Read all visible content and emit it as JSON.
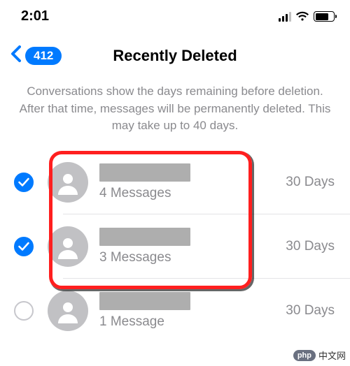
{
  "status": {
    "time": "2:01"
  },
  "nav": {
    "back_count": "412",
    "title": "Recently Deleted"
  },
  "description": "Conversations show the days remaining before deletion. After that time, messages will be permanently deleted. This may take up to 40 days.",
  "rows": [
    {
      "selected": true,
      "messages": "4 Messages",
      "remaining": "30 Days"
    },
    {
      "selected": true,
      "messages": "3 Messages",
      "remaining": "30 Days"
    },
    {
      "selected": false,
      "messages": "1 Message",
      "remaining": "30 Days"
    }
  ],
  "watermark": {
    "badge": "php",
    "text": "中文网"
  }
}
